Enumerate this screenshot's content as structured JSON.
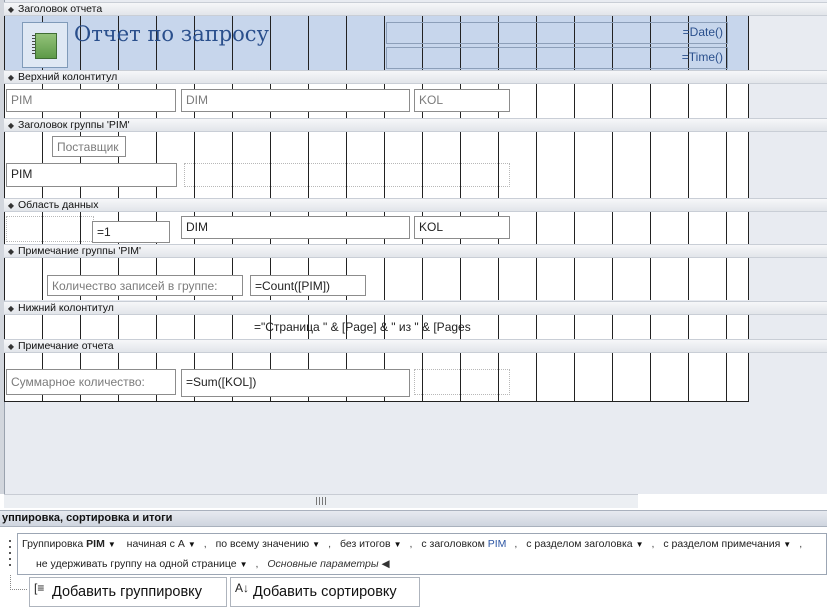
{
  "sections": {
    "report_header": "Заголовок отчета",
    "page_header": "Верхний колонтитул",
    "group_header": "Заголовок группы 'PIM'",
    "detail": "Область данных",
    "group_footer": "Примечание группы 'PIM'",
    "page_footer": "Нижний колонтитул",
    "report_footer": "Примечание отчета"
  },
  "report_header": {
    "title": "Отчет по запросу",
    "date_expr": "=Date()",
    "time_expr": "=Time()"
  },
  "page_header": {
    "pim": "PIM",
    "dim": "DIM",
    "kol": "KOL"
  },
  "group_header": {
    "supplier_label": "Поставщик",
    "pim_field": "PIM"
  },
  "detail": {
    "counter": "=1",
    "dim_field": "DIM",
    "kol_field": "KOL"
  },
  "group_footer": {
    "count_label": "Количество записей в группе:",
    "count_expr": "=Count([PIM])"
  },
  "page_footer": {
    "page_expr": "=\"Страница \" & [Page] & \" из \" & [Pages"
  },
  "report_footer": {
    "sum_label": "Суммарное количество:",
    "sum_expr": "=Sum([KOL])"
  },
  "grouping_pane": {
    "title": "уппировка, сортировка и итоги",
    "group_by": "Группировка",
    "group_field": "PIM",
    "sort_order": "начиная с А",
    "group_on": "по всему значению",
    "totals": "без итогов",
    "with_header_prefix": "с заголовком",
    "with_header_field": "PIM",
    "header_section": "с разделом заголовка",
    "footer_section": "с разделом примечания",
    "keep_together": "не удерживать группу на одной странице",
    "less_options": "Основные параметры",
    "add_group_button": "Добавить группировку",
    "add_sort_button": "Добавить сортировку"
  }
}
